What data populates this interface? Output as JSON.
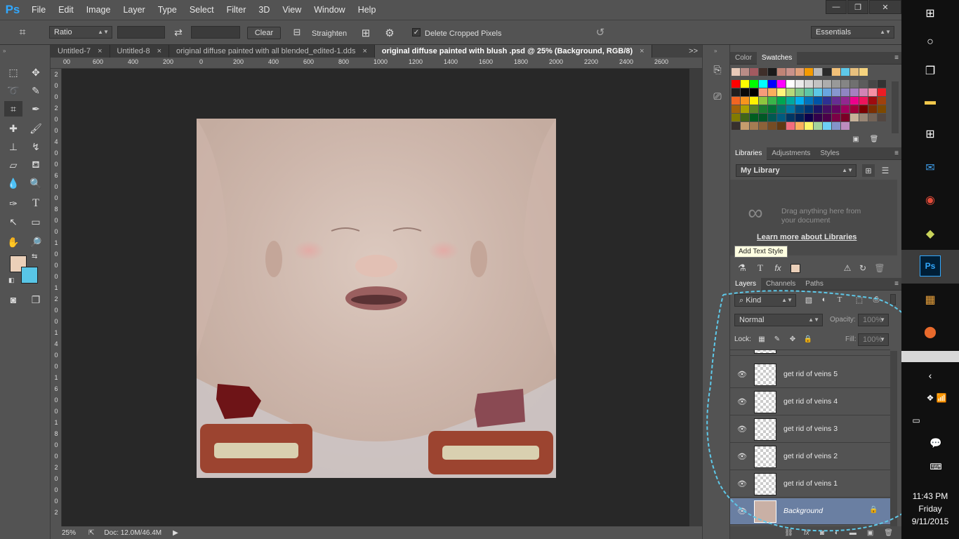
{
  "app": {
    "logo": "Ps",
    "menu": [
      "File",
      "Edit",
      "Image",
      "Layer",
      "Type",
      "Select",
      "Filter",
      "3D",
      "View",
      "Window",
      "Help"
    ]
  },
  "window_controls": {
    "minimize": "—",
    "restore": "❐",
    "close": "✕"
  },
  "options": {
    "ratio_select": "Ratio",
    "clear_label": "Clear",
    "straighten_label": "Straighten",
    "delete_cropped_label": "Delete Cropped Pixels",
    "delete_cropped_checked": true,
    "workspace": "Essentials"
  },
  "tabs": [
    {
      "label": "Untitled-7",
      "close": "×",
      "active": false
    },
    {
      "label": "Untitled-8",
      "close": "×",
      "active": false
    },
    {
      "label": "original diffuse painted with all blended_edited-1.dds",
      "close": "×",
      "active": false
    },
    {
      "label": "original diffuse painted with blush .psd @ 25% (Background, RGB/8)",
      "close": "×",
      "active": true
    }
  ],
  "tabs_overflow": ">>",
  "ruler_top": [
    "00",
    "600",
    "400",
    "200",
    "0",
    "200",
    "400",
    "600",
    "800",
    "1000",
    "1200",
    "1400",
    "1600",
    "1800",
    "2000",
    "2200",
    "2400",
    "2600"
  ],
  "ruler_left": [
    "2",
    "0",
    "0",
    "2",
    "0",
    "0",
    "4",
    "0",
    "0",
    "6",
    "0",
    "0",
    "8",
    "0",
    "0",
    "1",
    "0",
    "0",
    "0",
    "1",
    "2",
    "0",
    "0",
    "1",
    "4",
    "0",
    "0",
    "1",
    "6",
    "0",
    "0",
    "1",
    "8",
    "0",
    "0",
    "2",
    "0",
    "0",
    "0",
    "2"
  ],
  "status": {
    "zoom": "25%",
    "doc": "Doc: 12.0M/46.4M"
  },
  "color_panel": {
    "tabs": [
      "Color",
      "Swatches"
    ],
    "active": "Swatches"
  },
  "swatch_colors": {
    "recent": [
      "#e7c9b8",
      "#b98c86",
      "#a35a60",
      "#3f2f2a",
      "#1a1a1a",
      "#c08476",
      "#c9928a",
      "#e0a07a",
      "#f59a00",
      "#b8b8b8",
      "#2a2a2a",
      "#f2c078",
      "#5ec8e8",
      "#e8c07e",
      "#f5d37e"
    ],
    "grid": [
      "#ff0000",
      "#ffff00",
      "#00ff00",
      "#00ffff",
      "#0000ff",
      "#ff00ff",
      "#ffffff",
      "#ebebeb",
      "#d6d6d6",
      "#c2c2c2",
      "#adadad",
      "#999999",
      "#858585",
      "#707070",
      "#5c5c5c",
      "#474747",
      "#333333",
      "#1f1f1f",
      "#0a0a0a",
      "#000000",
      "#f79b7a",
      "#fbae5c",
      "#fff57a",
      "#b5d87a",
      "#80c88a",
      "#5fc6a6",
      "#5cc8e6",
      "#69a5e0",
      "#8797cf",
      "#8f86c2",
      "#a67fc0",
      "#d283b5",
      "#f68fa4",
      "#ed1c24",
      "#f26522",
      "#f7941d",
      "#fff200",
      "#8dc63f",
      "#39b54a",
      "#00a651",
      "#00a99d",
      "#00aeef",
      "#0072bc",
      "#0054a6",
      "#2e3192",
      "#662d91",
      "#92278f",
      "#ec008c",
      "#ed145b",
      "#9e0b0f",
      "#a0410d",
      "#a36209",
      "#aba000",
      "#598527",
      "#1a7b30",
      "#007236",
      "#00746b",
      "#0076a3",
      "#004b80",
      "#003471",
      "#1b1464",
      "#440e62",
      "#630460",
      "#9e005d",
      "#9e0039",
      "#790000",
      "#7b2e00",
      "#7d4900",
      "#827b00",
      "#406618",
      "#005e20",
      "#005826",
      "#005952",
      "#005b7f",
      "#003663",
      "#002157",
      "#0d004c",
      "#32004b",
      "#4b0049",
      "#7b0046",
      "#7a0026",
      "#c7b299",
      "#998675",
      "#736357",
      "#534741",
      "#37302d",
      "#c69c6d",
      "#a67c52",
      "#8c6239",
      "#754c24",
      "#603913",
      "#f26d7d",
      "#fbaf5d",
      "#fff568",
      "#a3d39c",
      "#6dcff6",
      "#8493ca",
      "#bd8cbf"
    ]
  },
  "libraries_panel": {
    "tabs": [
      "Libraries",
      "Adjustments",
      "Styles"
    ],
    "active": "Libraries",
    "library_select": "My Library",
    "drag_text_1": "Drag anything here from",
    "drag_text_2": "your document",
    "learn_more": "Learn more about Libraries",
    "tooltip": "Add Text Style"
  },
  "layers_panel": {
    "tabs": [
      "Layers",
      "Channels",
      "Paths"
    ],
    "active": "Layers",
    "kind_select": "Kind",
    "blend_mode": "Normal",
    "opacity_label": "Opacity:",
    "opacity_value": "100%",
    "lock_label": "Lock:",
    "fill_label": "Fill:",
    "fill_value": "100%",
    "layers": [
      {
        "name": "get rid of veins 5",
        "selected": false
      },
      {
        "name": "get rid of veins 4",
        "selected": false
      },
      {
        "name": "get rid of veins 3",
        "selected": false
      },
      {
        "name": "get rid of veins 2",
        "selected": false
      },
      {
        "name": "get rid of veins 1",
        "selected": false
      },
      {
        "name": "Background",
        "selected": true
      }
    ],
    "footer_icons": [
      "link-icon",
      "fx-icon",
      "mask-icon",
      "adjustment-icon",
      "folder-icon",
      "new-layer-icon",
      "trash-icon"
    ]
  },
  "taskbar": {
    "time": "11:43 PM",
    "day": "Friday",
    "date": "9/11/2015"
  },
  "colors": {
    "foreground": "#ebd0b9",
    "background": "#58c5e6",
    "accent_blue": "#31a8ff",
    "selected_layer": "#6a7fa2"
  }
}
